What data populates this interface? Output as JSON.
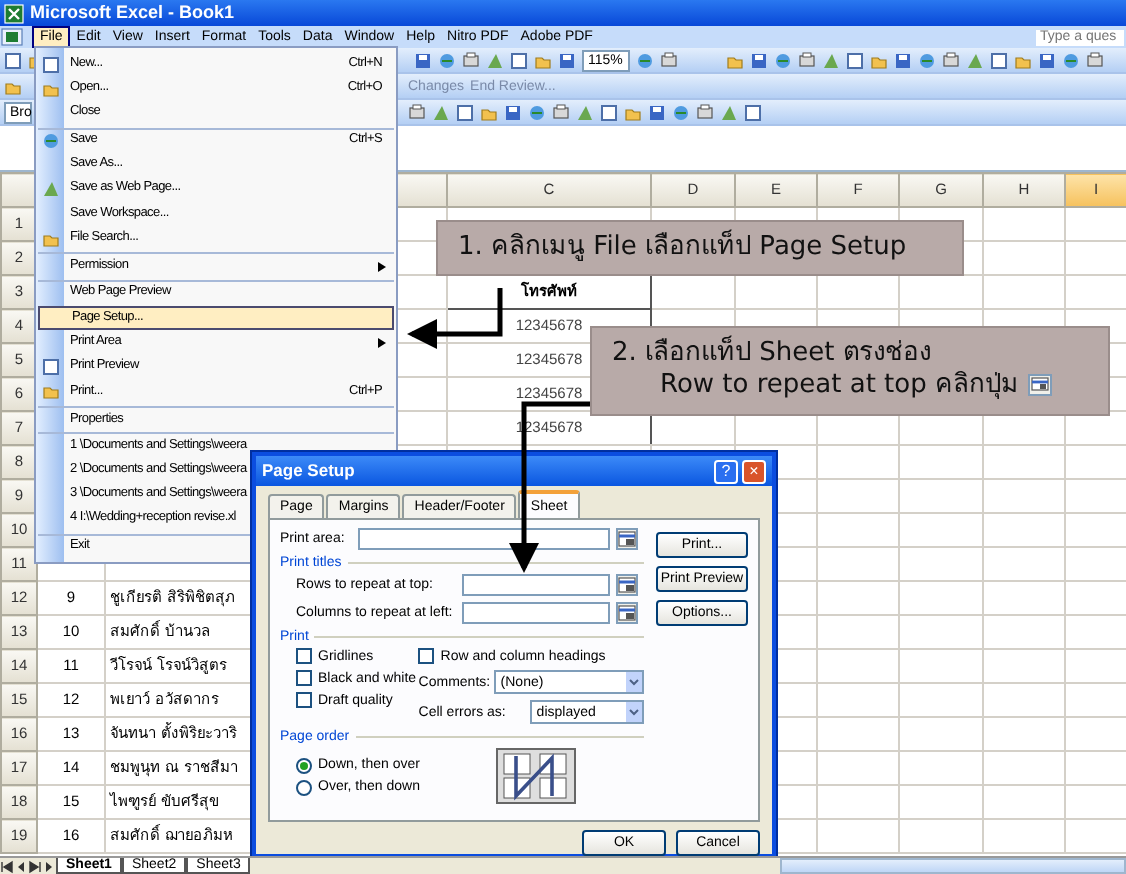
{
  "window": {
    "title": "Microsoft Excel - Book1"
  },
  "menu_bar": {
    "items": [
      {
        "label": "File",
        "selected": true
      },
      {
        "label": "Edit",
        "selected": false
      },
      {
        "label": "View",
        "selected": false
      },
      {
        "label": "Insert",
        "selected": false
      },
      {
        "label": "Format",
        "selected": false
      },
      {
        "label": "Tools",
        "selected": false
      },
      {
        "label": "Data",
        "selected": false
      },
      {
        "label": "Window",
        "selected": false
      },
      {
        "label": "Help",
        "selected": false
      },
      {
        "label": "Nitro PDF",
        "selected": false
      },
      {
        "label": "Adobe PDF",
        "selected": false
      }
    ],
    "help_placeholder": "Type a ques"
  },
  "toolbars": {
    "font_name": "Bro",
    "zoom": "115%",
    "review": [
      "Changes",
      "End Review..."
    ]
  },
  "columns": [
    {
      "label": "C",
      "selected": false
    },
    {
      "label": "D",
      "selected": false
    },
    {
      "label": "E",
      "selected": false
    },
    {
      "label": "F",
      "selected": false
    },
    {
      "label": "G",
      "selected": false
    },
    {
      "label": "H",
      "selected": false
    },
    {
      "label": "I",
      "selected": true
    }
  ],
  "rows": [
    {
      "number": "1"
    },
    {
      "number": "2"
    },
    {
      "number": "3",
      "column_c_heading": "โทรศัพท์"
    },
    {
      "number": "4",
      "column_c": "12345678"
    },
    {
      "number": "5",
      "column_c": "12345678"
    },
    {
      "number": "6",
      "column_c": "12345678"
    },
    {
      "number": "7",
      "column_c": "12345678"
    },
    {
      "number": "8"
    },
    {
      "number": "9"
    },
    {
      "number": "10"
    },
    {
      "number": "11"
    },
    {
      "number": "12",
      "column_a": "9",
      "column_b": "ชูเกียรติ สิริพิชิตสุภ"
    },
    {
      "number": "13",
      "column_a": "10",
      "column_b": "สมศักดิ์ บ้านวล"
    },
    {
      "number": "14",
      "column_a": "11",
      "column_b": "วีโรจน์ โรจน์วิสูตร"
    },
    {
      "number": "15",
      "column_a": "12",
      "column_b": "พเยาว์ อวัสดากร"
    },
    {
      "number": "16",
      "column_a": "13",
      "column_b": "จันทนา ตั้งพิริยะวาริ"
    },
    {
      "number": "17",
      "column_a": "14",
      "column_b": "ชมพูนุท ณ ราชสีมา"
    },
    {
      "number": "18",
      "column_a": "15",
      "column_b": "ไพฑูรย์ ขับศรีสุข"
    },
    {
      "number": "19",
      "column_a": "16",
      "column_b": "สมศักดิ์ ฌายอภิมห"
    }
  ],
  "file_menu": [
    {
      "label": "New...",
      "shortcut": "Ctrl+N",
      "has_icon": true,
      "submenu": false,
      "separator_before": false,
      "selected": false
    },
    {
      "label": "Open...",
      "shortcut": "Ctrl+O",
      "has_icon": true,
      "submenu": false,
      "separator_before": false,
      "selected": false
    },
    {
      "label": "Close",
      "has_icon": false,
      "submenu": false,
      "separator_before": false,
      "selected": false
    },
    {
      "label": "Save",
      "shortcut": "Ctrl+S",
      "has_icon": true,
      "submenu": false,
      "separator_before": true,
      "selected": false
    },
    {
      "label": "Save As...",
      "has_icon": false,
      "submenu": false,
      "separator_before": false,
      "selected": false
    },
    {
      "label": "Save as Web Page...",
      "has_icon": true,
      "submenu": false,
      "separator_before": false,
      "selected": false
    },
    {
      "label": "Save Workspace...",
      "has_icon": false,
      "submenu": false,
      "separator_before": false,
      "selected": false
    },
    {
      "label": "File Search...",
      "has_icon": true,
      "submenu": false,
      "separator_before": false,
      "selected": false
    },
    {
      "label": "Permission",
      "has_icon": false,
      "submenu": true,
      "separator_before": true,
      "selected": false
    },
    {
      "label": "Web Page Preview",
      "has_icon": false,
      "submenu": false,
      "separator_before": true,
      "selected": false
    },
    {
      "label": "Page Setup...",
      "has_icon": false,
      "submenu": false,
      "separator_before": true,
      "selected": true
    },
    {
      "label": "Print Area",
      "has_icon": false,
      "submenu": true,
      "separator_before": false,
      "selected": false
    },
    {
      "label": "Print Preview",
      "has_icon": true,
      "submenu": false,
      "separator_before": false,
      "selected": false
    },
    {
      "label": "Print...",
      "shortcut": "Ctrl+P",
      "has_icon": true,
      "submenu": false,
      "separator_before": false,
      "selected": false
    },
    {
      "label": "Properties",
      "has_icon": false,
      "submenu": false,
      "separator_before": true,
      "selected": false
    },
    {
      "label": "1 \\Documents and Settings\\weera",
      "has_icon": false,
      "separator_before": true,
      "selected": false
    },
    {
      "label": "2 \\Documents and Settings\\weera",
      "has_icon": false,
      "separator_before": false,
      "selected": false
    },
    {
      "label": "3 \\Documents and Settings\\weera",
      "has_icon": false,
      "separator_before": false,
      "selected": false
    },
    {
      "label": "4 I:\\Wedding+reception revise.xl",
      "has_icon": false,
      "separator_before": false,
      "selected": false
    },
    {
      "label": "Exit",
      "has_icon": false,
      "submenu": false,
      "separator_before": true,
      "selected": false
    }
  ],
  "dialog": {
    "title": "Page Setup",
    "title_buttons": [
      "?",
      "×"
    ],
    "tabs": [
      {
        "label": "Page",
        "selected": false
      },
      {
        "label": "Margins",
        "selected": false
      },
      {
        "label": "Header/Footer",
        "selected": false
      },
      {
        "label": "Sheet",
        "selected": true
      }
    ],
    "print_area_label": "Print area:",
    "print_titles_heading": "Print titles",
    "rows_label": "Rows to repeat at top:",
    "columns_label": "Columns to repeat at left:",
    "print_heading": "Print",
    "checkboxes": [
      {
        "label": "Gridlines",
        "checked": false
      },
      {
        "label": "Black and white",
        "checked": false
      },
      {
        "label": "Draft quality",
        "checked": false
      },
      {
        "label": "Row and column headings",
        "checked": false
      }
    ],
    "comments_label": "Comments:",
    "comments_value": "(None)",
    "cell_errors_label": "Cell errors as:",
    "cell_errors_value": "displayed",
    "page_order_heading": "Page order",
    "page_order": [
      {
        "label": "Down, then over",
        "selected": true
      },
      {
        "label": "Over, then down",
        "selected": false
      }
    ],
    "side_buttons": [
      "Print...",
      "Print Preview",
      "Options..."
    ],
    "footer_buttons": [
      "OK",
      "Cancel"
    ]
  },
  "callouts": [
    {
      "lines": [
        "1. คลิกเมนู File เลือกแท็ป Page Setup"
      ],
      "button_icon": false
    },
    {
      "lines": [
        "2. เลือกแท็ป Sheet ตรงช่อง",
        "Row to repeat at top คลิกปุ่ม"
      ],
      "button_icon": true
    }
  ],
  "sheet_tabs": [
    {
      "label": "Sheet1",
      "selected": true
    },
    {
      "label": "Sheet2",
      "selected": false
    },
    {
      "label": "Sheet3",
      "selected": false
    }
  ]
}
